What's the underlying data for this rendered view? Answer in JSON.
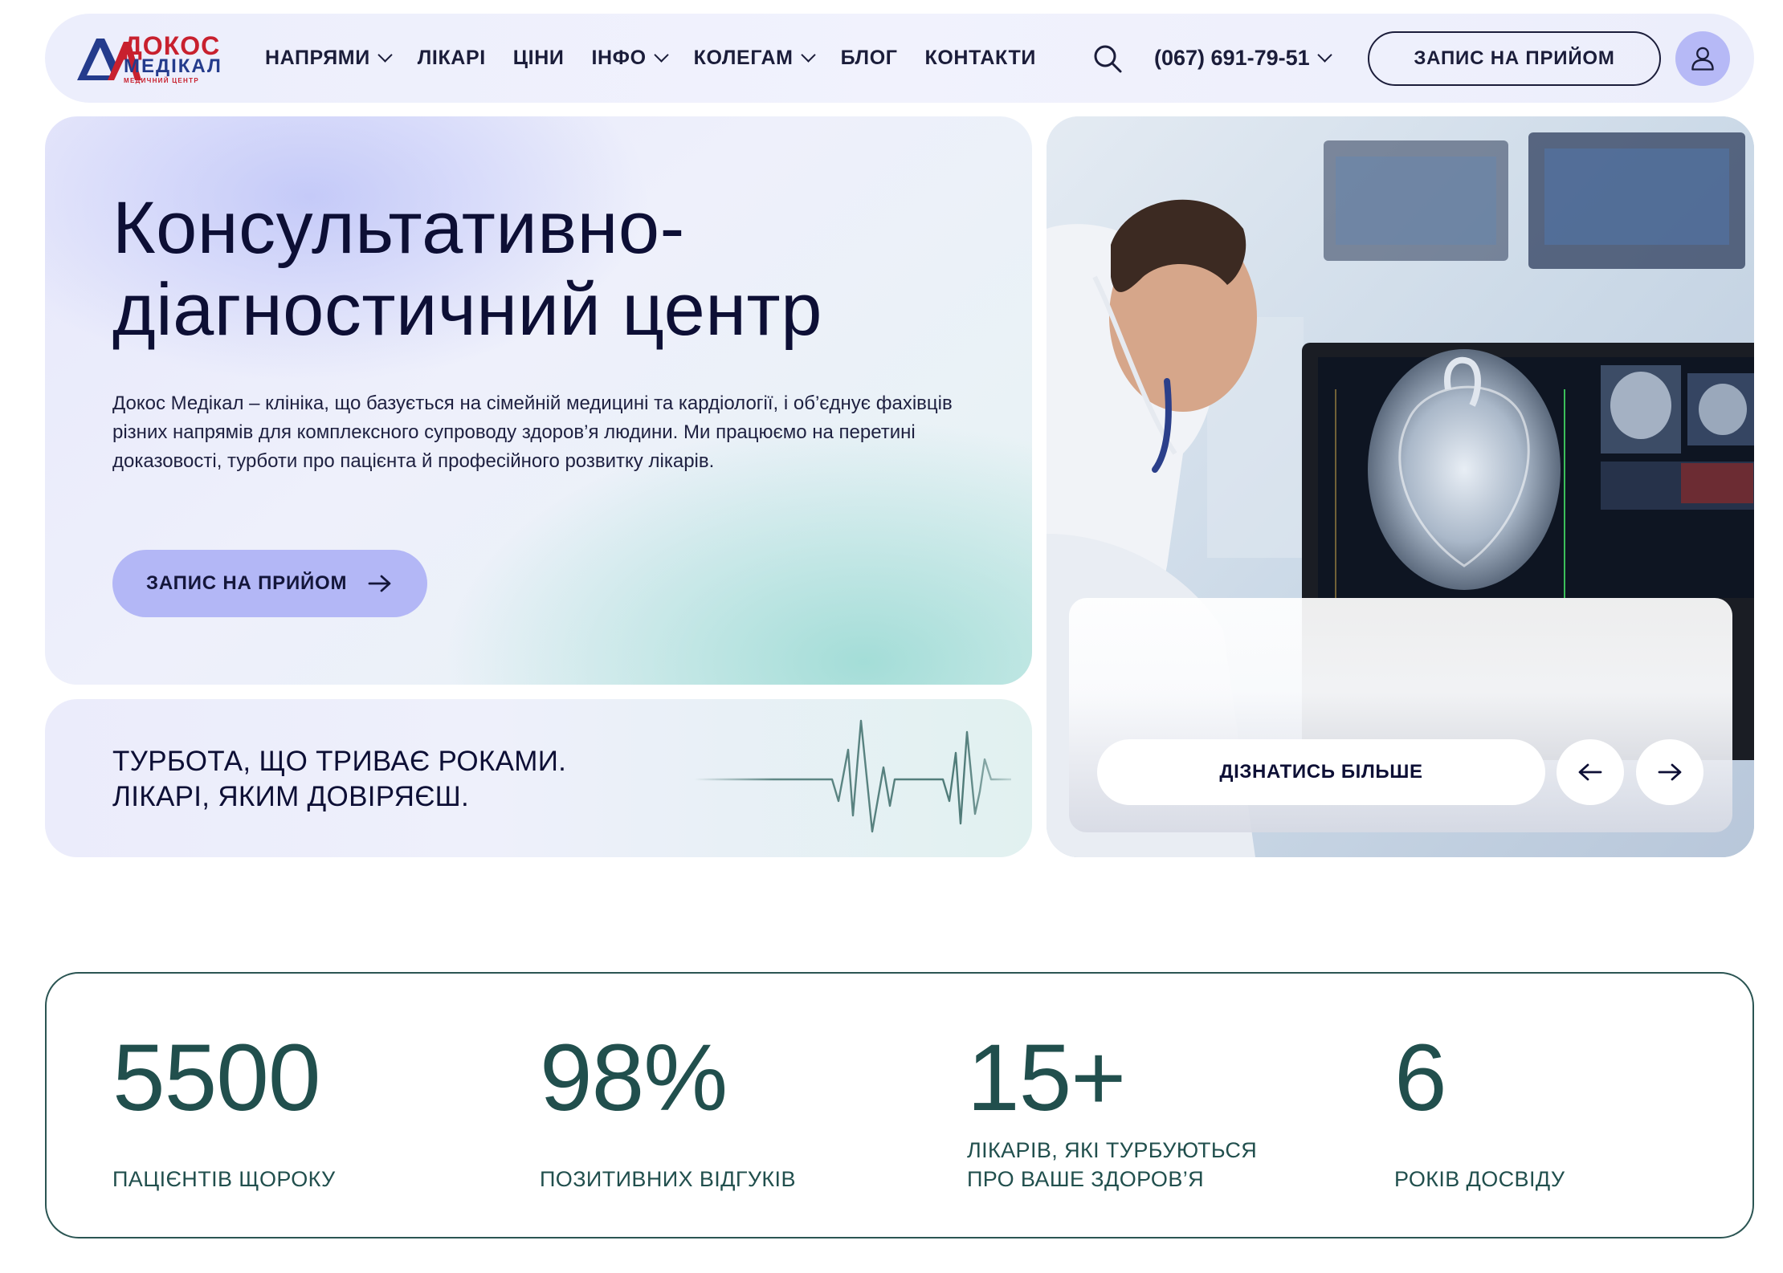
{
  "logo": {
    "name": "ДОКОС",
    "subname": "МЕДІКАЛ",
    "tagline": "МЕДИЧНИЙ ЦЕНТР"
  },
  "nav": {
    "items": [
      {
        "label": "НАПРЯМИ",
        "dropdown": true
      },
      {
        "label": "ЛІКАРІ",
        "dropdown": false
      },
      {
        "label": "ЦІНИ",
        "dropdown": false
      },
      {
        "label": "ІНФО",
        "dropdown": true
      },
      {
        "label": "КОЛЕГАМ",
        "dropdown": true
      },
      {
        "label": "БЛОГ",
        "dropdown": false
      },
      {
        "label": "КОНТАКТИ",
        "dropdown": false
      }
    ]
  },
  "header": {
    "phone": "(067) 691-79-51",
    "appointment_button": "ЗАПИС НА ПРИЙОМ",
    "search_icon": "search-icon",
    "user_icon": "user-icon"
  },
  "hero": {
    "title_line1": "Консультативно-",
    "title_line2": "діагностичний центр",
    "description": "Докос Медікал – клініка, що базується на сімейній медицині та кардіології, і об’єднує фахівців різних напрямів для комплексного супроводу здоров’я людини. Ми працюємо на перетині доказовості, турботи про пацієнта й професійного розвитку лікарів.",
    "cta_label": "ЗАПИС НА ПРИЙОМ"
  },
  "tagline": {
    "line1": "ТУРБОТА, ЩО ТРИВАЄ РОКАМИ.",
    "line2": "ЛІКАРІ, ЯКИМ ДОВІРЯЄШ."
  },
  "slider": {
    "more_label": "ДІЗНАТИСЬ БІЛЬШЕ",
    "prev_icon": "arrow-left-icon",
    "next_icon": "arrow-right-icon"
  },
  "stats": [
    {
      "value": "5500",
      "label_line1": "ПАЦІЄНТІВ ЩОРОКУ",
      "label_line2": ""
    },
    {
      "value": "98%",
      "label_line1": "ПОЗИТИВНИХ ВІДГУКІВ",
      "label_line2": ""
    },
    {
      "value": "15+",
      "label_line1": "ЛІКАРІВ, ЯКІ ТУРБУЮТЬСЯ",
      "label_line2": "ПРО ВАШЕ ЗДОРОВ’Я"
    },
    {
      "value": "6",
      "label_line1": "РОКІВ ДОСВІДУ",
      "label_line2": ""
    }
  ],
  "colors": {
    "accent": "#b3b7f6",
    "dark_text": "#0d0f35",
    "stat_green": "#214f4d",
    "logo_red": "#c8202e",
    "logo_blue": "#243b8c"
  }
}
